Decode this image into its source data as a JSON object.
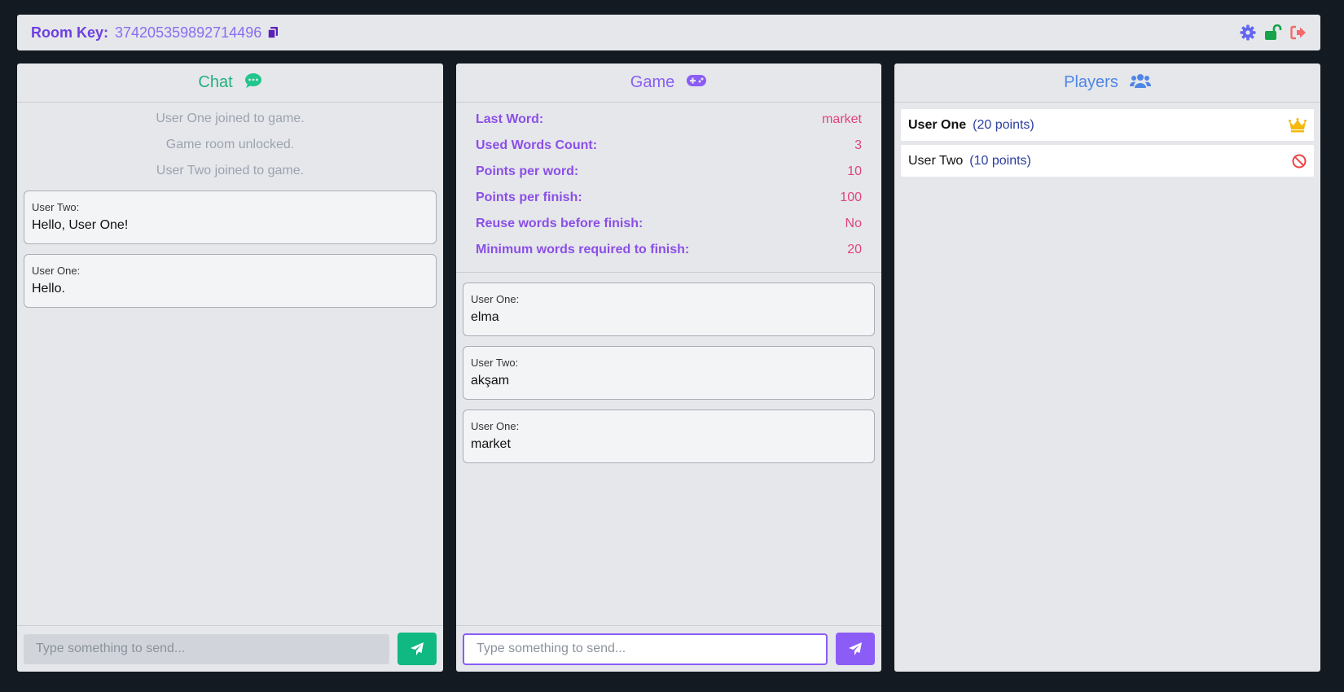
{
  "topbar": {
    "room_label": "Room Key:",
    "room_key": "374205359892714496",
    "icons": [
      "copy-icon",
      "gear-icon",
      "unlock-icon",
      "logout-icon"
    ]
  },
  "chat": {
    "title": "Chat",
    "icon": "chat-bubble-icon",
    "system_messages": [
      "User One joined to game.",
      "Game room unlocked.",
      "User Two joined to game."
    ],
    "messages": [
      {
        "author": "User Two:",
        "text": "Hello, User One!"
      },
      {
        "author": "User One:",
        "text": "Hello."
      }
    ],
    "input_placeholder": "Type something to send...",
    "send_icon": "paper-plane-icon"
  },
  "game": {
    "title": "Game",
    "icon": "gamepad-icon",
    "stats": [
      {
        "label": "Last Word:",
        "value": "market"
      },
      {
        "label": "Used Words Count:",
        "value": "3"
      },
      {
        "label": "Points per word:",
        "value": "10"
      },
      {
        "label": "Points per finish:",
        "value": "100"
      },
      {
        "label": "Reuse words before finish:",
        "value": "No"
      },
      {
        "label": "Minimum words required to finish:",
        "value": "20"
      }
    ],
    "words": [
      {
        "author": "User One:",
        "text": "elma"
      },
      {
        "author": "User Two:",
        "text": "akşam"
      },
      {
        "author": "User One:",
        "text": "market"
      }
    ],
    "input_placeholder": "Type something to send...",
    "send_icon": "paper-plane-icon"
  },
  "players": {
    "title": "Players",
    "icon": "users-icon",
    "list": [
      {
        "name": "User One",
        "points": "(20 points)",
        "icon": "crown-icon"
      },
      {
        "name": "User Two",
        "points": "(10 points)",
        "icon": "ban-icon"
      }
    ]
  },
  "colors": {
    "background": "#131a21",
    "chat_accent": "#10b981",
    "game_accent": "#8b5cf6",
    "players_accent": "#4f86e6",
    "stat_value": "#e0447a",
    "crown": "#f5b90b",
    "ban": "#ef4444",
    "logout": "#f26a6a",
    "unlock": "#16a34a"
  }
}
